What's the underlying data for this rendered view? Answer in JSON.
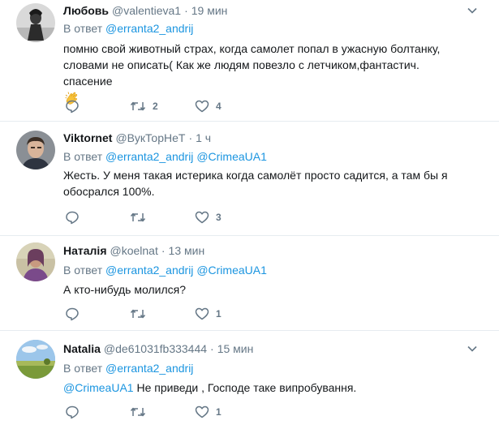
{
  "reply_prefix": "В ответ",
  "tweets": [
    {
      "name": "Любовь",
      "handle": "@valentieva1",
      "time": "19 мин",
      "mentions": [
        "@erranta2_andrij"
      ],
      "text": "помню свой животный страх, когда самолет попал в ужасную болтанку, словами не описать( Как же людям повезло с летчиком,фантастич. спасение",
      "emoji": "clap-hands-icon",
      "replies": "",
      "retweets": "2",
      "likes": "4"
    },
    {
      "name": "Viktornet",
      "handle": "@ВукТорНеТ",
      "time": "1 ч",
      "mentions": [
        "@erranta2_andrij",
        "@CrimeaUA1"
      ],
      "text": "Жесть. У меня такая истерика когда самолёт просто садится, а там бы я обосрался 100%.",
      "replies": "",
      "retweets": "",
      "likes": "3"
    },
    {
      "name": "Наталія",
      "handle": "@koelnat",
      "time": "13 мин",
      "mentions": [
        "@erranta2_andrij",
        "@CrimeaUA1"
      ],
      "text": "А кто-нибудь молился?",
      "replies": "",
      "retweets": "",
      "likes": "1"
    },
    {
      "name": "Natalia",
      "handle": "@de61031fb333444",
      "time": "15 мин",
      "mentions": [
        "@erranta2_andrij"
      ],
      "text_mention": "@CrimeaUA1",
      "text": "Не приведи , Господе таке випробування.",
      "replies": "",
      "retweets": "",
      "likes": "1"
    }
  ],
  "colors": {
    "link": "#1b95e0",
    "secondary": "#657786",
    "divider": "#e6ecf0"
  }
}
